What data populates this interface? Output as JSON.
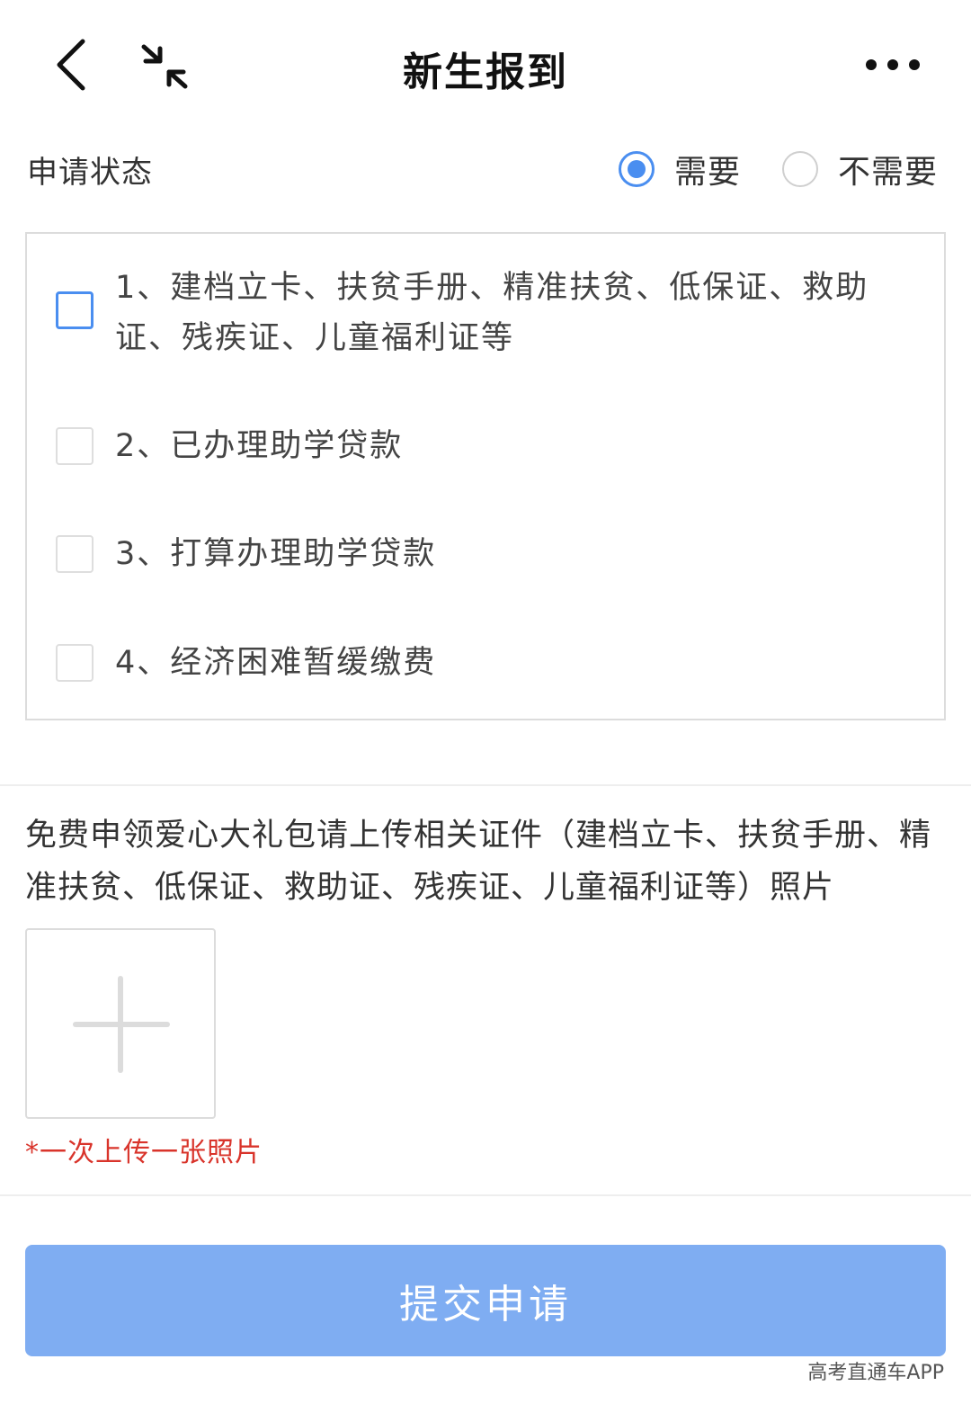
{
  "nav": {
    "title": "新生报到",
    "back_icon": "chevron-left-icon",
    "collapse_icon": "collapse-arrows-icon",
    "more_icon": "more-dots-icon"
  },
  "status": {
    "label": "申请状态",
    "options": [
      {
        "label": "需要",
        "selected": true
      },
      {
        "label": "不需要",
        "selected": false
      }
    ]
  },
  "aid_options": [
    {
      "label": "1、建档立卡、扶贫手册、精准扶贫、低保证、救助证、残疾证、儿童福利证等",
      "checked": false
    },
    {
      "label": "2、已办理助学贷款",
      "checked": false
    },
    {
      "label": "3、打算办理助学贷款",
      "checked": false
    },
    {
      "label": "4、经济困难暂缓缴费",
      "checked": false
    }
  ],
  "upload": {
    "description": "免费申领爱心大礼包请上传相关证件（建档立卡、扶贫手册、精准扶贫、低保证、救助证、残疾证、儿童福利证等）照片",
    "add_icon": "plus-icon",
    "note": "*一次上传一张照片"
  },
  "submit_label": "提交申请",
  "watermark": "高考直通车APP",
  "colors": {
    "accent": "#4a8ef0",
    "button": "#7fadf2",
    "note_red": "#d9342b"
  }
}
